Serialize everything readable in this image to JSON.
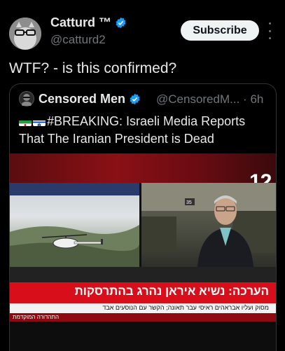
{
  "post": {
    "author_name": "Catturd ™",
    "author_handle": "@catturd2",
    "subscribe_label": "Subscribe",
    "text": "WTF? - is this confirmed?"
  },
  "quote": {
    "author_name": "Censored Men",
    "author_handle": "@CensoredM...",
    "separator": "·",
    "time": "6h",
    "text": "#BREAKING: Israeli Media Reports That The Iranian President is Dead"
  },
  "media": {
    "channel_logo": "12",
    "chyron_headline": "הערכה: נשיא איראן נהרג בהתרסקות",
    "chyron_subline": "מסוק ועליו אבראהים ראיסי עבר תאונה; הקשר עם הנוסעים אבד",
    "chyron_tag": "התהדורה המוקדמת"
  },
  "icons": {
    "verified_color": "#1d9bf0",
    "more": "more-dots-icon"
  }
}
